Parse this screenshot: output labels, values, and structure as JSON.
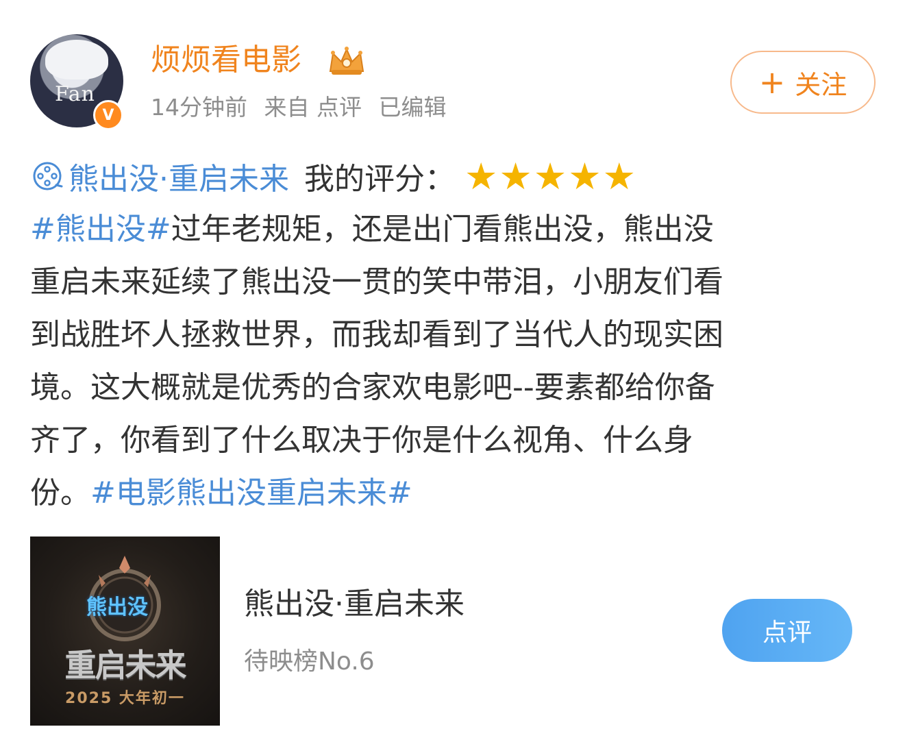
{
  "header": {
    "username": "烦烦看电影",
    "time": "14分钟前",
    "source": "来自 点评",
    "edited": "已编辑",
    "follow_label": "关注",
    "follow_plus": "+",
    "avatar_text": "Fan",
    "verified_mark": "V"
  },
  "rating": {
    "movie_link": "熊出没·重启未来",
    "label": "我的评分：",
    "stars": "★★★★★",
    "star_color": "#f5b400"
  },
  "post": {
    "tag1": "#熊出没#",
    "line1": "过年老规矩，还是出门看熊出没，熊出没",
    "line2": "重启未来延续了熊出没一贯的笑中带泪，小朋友们看",
    "line3": "到战胜坏人拯救世界，而我却看到了当代人的现实困",
    "line4": "境。这大概就是优秀的合家欢电影吧--要素都给你备",
    "line5": "齐了，你看到了什么取决于你是什么视角、什么身",
    "line6_text": "份。",
    "tag2": "#电影熊出没重启未来#"
  },
  "card": {
    "title": "熊出没·重启未来",
    "subtitle": "待映榜No.6",
    "button_label": "点评",
    "poster_logo": "熊出没",
    "poster_title": "重启未来",
    "poster_date": "2025  大年初一"
  },
  "colors": {
    "username": "#f0841e",
    "link": "#4a8cd6",
    "button": "#4fa3f0"
  }
}
